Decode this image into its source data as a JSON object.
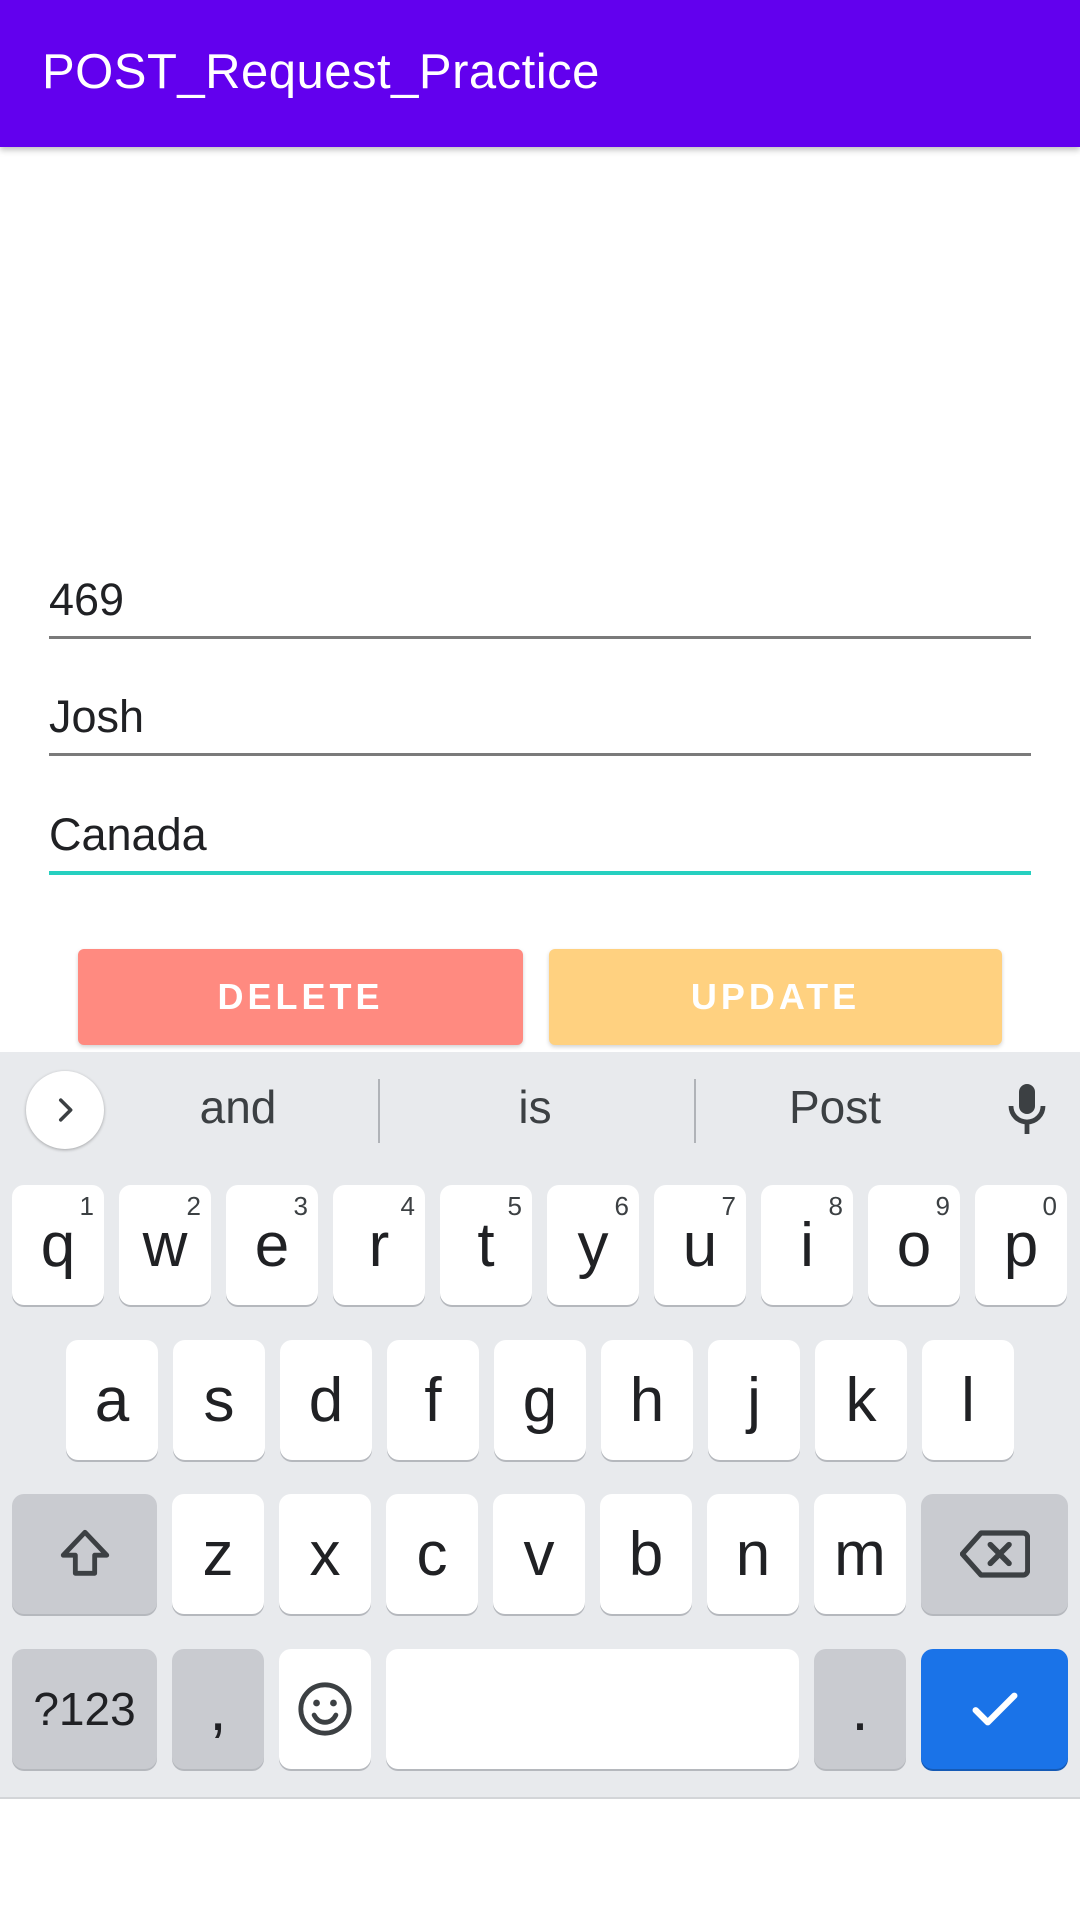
{
  "app_bar": {
    "title": "POST_Request_Practice"
  },
  "form": {
    "id_value": "469",
    "name_value": "Josh",
    "country_value": "Canada"
  },
  "buttons": {
    "delete_label": "DELETE",
    "update_label": "UPDATE"
  },
  "colors": {
    "app_bar": "#6200ee",
    "delete": "#ff8a80",
    "update": "#ffd180",
    "active_underline": "#26d0c0",
    "enter_key": "#1a73e8"
  },
  "keyboard": {
    "suggestions": [
      "and",
      "is",
      "Post"
    ],
    "row1": [
      {
        "k": "q",
        "h": "1"
      },
      {
        "k": "w",
        "h": "2"
      },
      {
        "k": "e",
        "h": "3"
      },
      {
        "k": "r",
        "h": "4"
      },
      {
        "k": "t",
        "h": "5"
      },
      {
        "k": "y",
        "h": "6"
      },
      {
        "k": "u",
        "h": "7"
      },
      {
        "k": "i",
        "h": "8"
      },
      {
        "k": "o",
        "h": "9"
      },
      {
        "k": "p",
        "h": "0"
      }
    ],
    "row2": [
      "a",
      "s",
      "d",
      "f",
      "g",
      "h",
      "j",
      "k",
      "l"
    ],
    "row3": [
      "z",
      "x",
      "c",
      "v",
      "b",
      "n",
      "m"
    ],
    "symbols_label": "?123",
    "comma_label": ",",
    "period_label": ".",
    "icons": [
      "chevron-right-icon",
      "mic-icon",
      "shift-icon",
      "backspace-icon",
      "emoji-icon",
      "check-icon"
    ]
  }
}
